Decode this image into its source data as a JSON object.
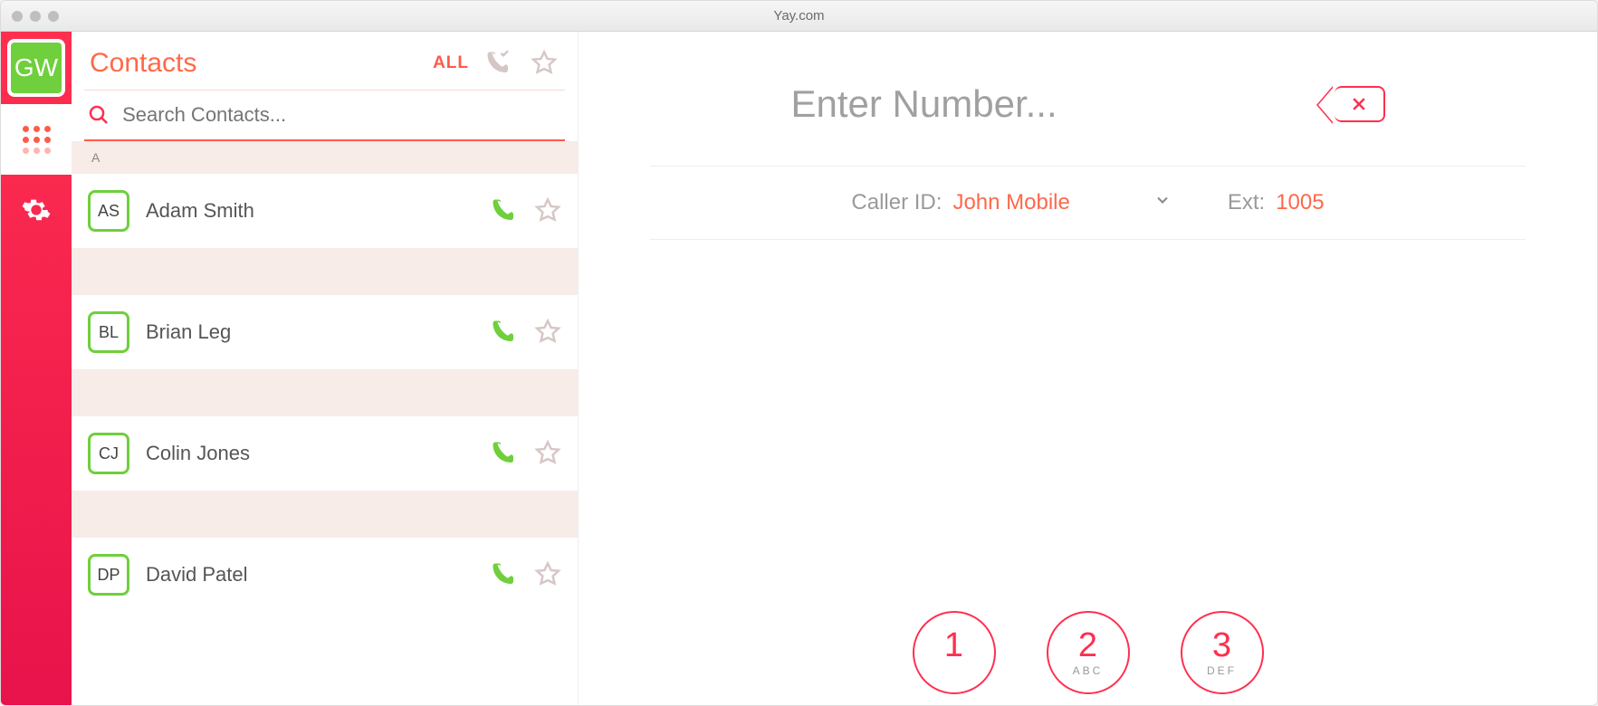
{
  "window": {
    "title": "Yay.com"
  },
  "sidebar": {
    "avatar_initials": "GW"
  },
  "contacts": {
    "title": "Contacts",
    "filter_all": "ALL",
    "search_placeholder": "Search Contacts...",
    "section_label": "A",
    "items": [
      {
        "initials": "AS",
        "name": "Adam Smith"
      },
      {
        "initials": "BL",
        "name": "Brian Leg"
      },
      {
        "initials": "CJ",
        "name": "Colin Jones"
      },
      {
        "initials": "DP",
        "name": "David Patel"
      }
    ]
  },
  "dialer": {
    "input_placeholder": "Enter Number...",
    "caller_id_label": "Caller ID:",
    "caller_id_value": "John Mobile",
    "ext_label": "Ext:",
    "ext_value": "1005",
    "keys": [
      {
        "digit": "1",
        "sub": ""
      },
      {
        "digit": "2",
        "sub": "ABC"
      },
      {
        "digit": "3",
        "sub": "DEF"
      }
    ]
  }
}
